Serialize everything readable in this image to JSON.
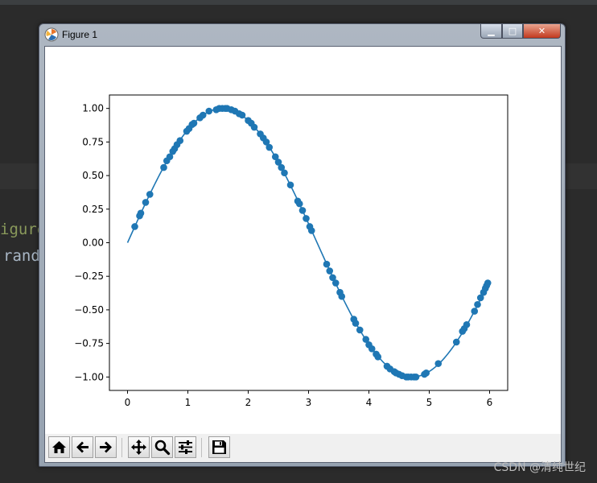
{
  "window": {
    "title": "Figure 1",
    "controls": {
      "minimize": "▁",
      "maximize": "□",
      "close": "✕"
    }
  },
  "background_code": {
    "line1": "igure",
    "line2": "rand"
  },
  "watermark": "CSDN @清纯世纪",
  "toolbar": {
    "tools": [
      "home-icon",
      "back-icon",
      "forward-icon",
      "pan-icon",
      "zoom-icon",
      "configure-subplots-icon",
      "save-icon"
    ]
  },
  "chart_data": {
    "type": "scatter",
    "title": "",
    "xlabel": "",
    "ylabel": "",
    "xlim": [
      -0.3,
      6.3
    ],
    "ylim": [
      -1.1,
      1.1
    ],
    "xticks": [
      "0",
      "1",
      "2",
      "3",
      "4",
      "5",
      "6"
    ],
    "yticks": [
      "−1.00",
      "−0.75",
      "−0.50",
      "−0.25",
      "0.00",
      "0.25",
      "0.50",
      "0.75",
      "1.00"
    ],
    "grid": false,
    "color": "#1f77b4",
    "series": [
      {
        "kind": "line",
        "function": "y = sin(x)",
        "x_range": [
          0,
          6
        ],
        "samples": 200
      },
      {
        "kind": "scatter",
        "x": [
          0.12,
          0.2,
          0.22,
          0.3,
          0.37,
          0.6,
          0.65,
          0.7,
          0.75,
          0.78,
          0.82,
          0.87,
          0.98,
          1.02,
          1.07,
          1.1,
          1.2,
          1.25,
          1.35,
          1.47,
          1.52,
          1.57,
          1.62,
          1.65,
          1.72,
          1.78,
          1.85,
          1.9,
          2.0,
          2.05,
          2.1,
          2.2,
          2.25,
          2.3,
          2.35,
          2.45,
          2.5,
          2.55,
          2.6,
          2.7,
          2.82,
          2.85,
          2.9,
          2.96,
          3.02,
          3.05,
          3.3,
          3.35,
          3.4,
          3.45,
          3.52,
          3.55,
          3.75,
          3.78,
          3.85,
          3.95,
          4.0,
          4.05,
          4.12,
          4.15,
          4.3,
          4.35,
          4.42,
          4.45,
          4.5,
          4.55,
          4.62,
          4.65,
          4.7,
          4.75,
          4.78,
          4.92,
          4.95,
          5.15,
          5.45,
          5.55,
          5.58,
          5.62,
          5.75,
          5.8,
          5.85,
          5.9,
          5.93,
          5.95,
          5.97
        ],
        "y": [
          0.12,
          0.2,
          0.22,
          0.3,
          0.36,
          0.56,
          0.61,
          0.64,
          0.68,
          0.7,
          0.73,
          0.76,
          0.83,
          0.85,
          0.88,
          0.89,
          0.93,
          0.95,
          0.98,
          0.99,
          1.0,
          1.0,
          1.0,
          1.0,
          0.99,
          0.98,
          0.96,
          0.95,
          0.91,
          0.89,
          0.86,
          0.81,
          0.78,
          0.75,
          0.71,
          0.64,
          0.6,
          0.56,
          0.52,
          0.43,
          0.31,
          0.29,
          0.24,
          0.18,
          0.12,
          0.09,
          -0.16,
          -0.21,
          -0.26,
          -0.3,
          -0.37,
          -0.4,
          -0.57,
          -0.6,
          -0.65,
          -0.72,
          -0.76,
          -0.79,
          -0.83,
          -0.85,
          -0.92,
          -0.94,
          -0.96,
          -0.97,
          -0.98,
          -0.99,
          -1.0,
          -1.0,
          -1.0,
          -1.0,
          -1.0,
          -0.98,
          -0.97,
          -0.9,
          -0.74,
          -0.66,
          -0.64,
          -0.61,
          -0.51,
          -0.46,
          -0.41,
          -0.37,
          -0.34,
          -0.32,
          -0.3
        ]
      }
    ]
  }
}
